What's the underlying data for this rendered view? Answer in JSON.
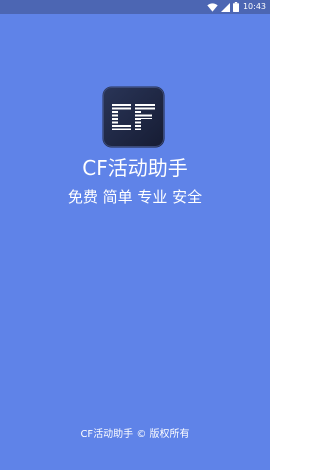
{
  "status_bar": {
    "time": "10:43",
    "icons": [
      "wifi-icon",
      "signal-icon",
      "battery-icon"
    ]
  },
  "splash": {
    "logo_icon": "cf-logo-icon",
    "app_name": "CF活动助手",
    "tagline": "免费 简单 专业 安全",
    "copyright": "CF活动助手 © 版权所有"
  },
  "colors": {
    "background": "#5f83e8",
    "status_bar": "#4c66b3",
    "logo_dark": "#1c2440",
    "logo_light": "#ffffff",
    "text": "#ffffff"
  }
}
